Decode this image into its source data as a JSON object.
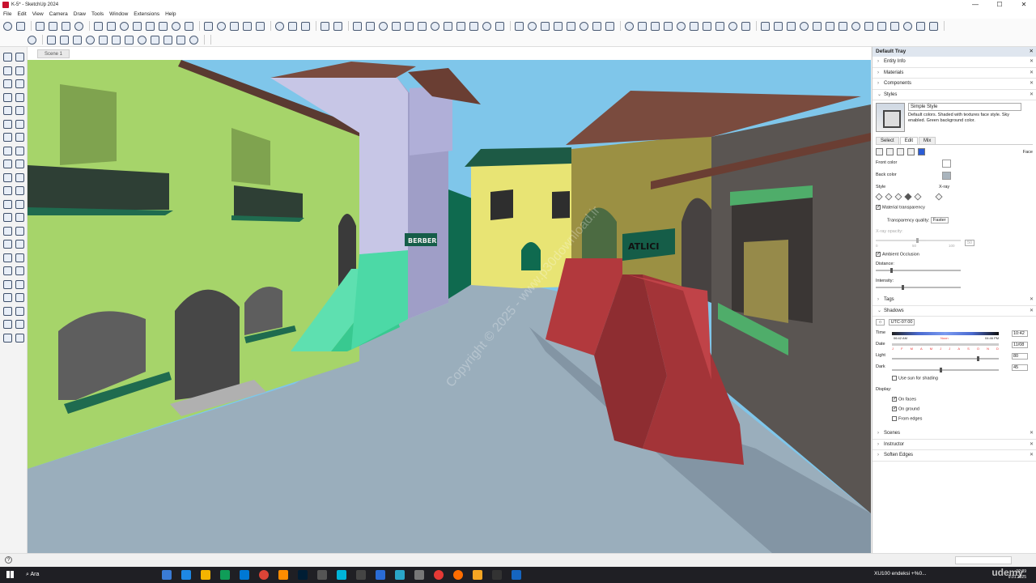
{
  "window": {
    "title": "K-5* - SketchUp 2024",
    "minimize": "—",
    "maximize": "☐",
    "close": "✕"
  },
  "menu": [
    "File",
    "Edit",
    "View",
    "Camera",
    "Draw",
    "Tools",
    "Window",
    "Extensions",
    "Help"
  ],
  "viewport": {
    "scene_tab": "Scene 1",
    "watermark": "Copyright © 2025 - www.p30download.ir",
    "signs": [
      "BERBER",
      "ATLICI"
    ]
  },
  "tray": {
    "title": "Default Tray",
    "close": "✕",
    "sections_top": [
      "Entity Info",
      "Materials",
      "Components"
    ],
    "styles": {
      "header": "Styles",
      "style_name": "Simple Style",
      "description": "Default colors. Shaded with textures face style. Sky enabled. Green background color.",
      "tabs": [
        "Select",
        "Edit",
        "Mix"
      ],
      "face_label": "Face",
      "front_color": "Front color",
      "back_color": "Back color",
      "style_label": "Style",
      "xray_label": "X-ray",
      "material_transparency": "Material transparency",
      "transparency_quality": "Transparency quality:",
      "transparency_value": "Faster",
      "xray_opacity": "X-ray opacity:",
      "xray_ticks": [
        "0",
        "50",
        "100"
      ],
      "xray_value": "50",
      "ambient_occlusion": "Ambient Occlusion",
      "distance": "Distance:",
      "intensity": "Intensity:"
    },
    "tags": "Tags",
    "shadows": {
      "header": "Shadows",
      "timezone": "UTC-07:00",
      "time_label": "Time",
      "time_start": "06:42 AM",
      "time_noon": "Noon",
      "time_end": "04:46 PM",
      "time_value": "10:42",
      "date_label": "Date",
      "months": [
        "J",
        "F",
        "M",
        "A",
        "M",
        "J",
        "J",
        "A",
        "S",
        "O",
        "N",
        "D"
      ],
      "date_value": "11/08",
      "light_label": "Light",
      "light_value": "80",
      "dark_label": "Dark",
      "dark_value": "45",
      "use_sun": "Use sun for shading",
      "display_label": "Display:",
      "on_faces": "On faces",
      "on_ground": "On ground",
      "from_edges": "From edges"
    },
    "sections_bottom": [
      "Scenes",
      "Instructor",
      "Soften Edges"
    ]
  },
  "statusbar": {
    "help": "?"
  },
  "taskbar": {
    "search": "Ara",
    "notification": "XU100 endeksi +%0...",
    "time": "12:39",
    "date": "9.01.2025",
    "udemy": "udemy"
  },
  "colors": {
    "sky": "#7fc6ea",
    "ground": "#9aaebc",
    "wall_green": "#a6d46a",
    "wall_lavender": "#c7c6e6",
    "wall_yellow": "#e8e474",
    "wall_olive": "#9b9043",
    "wall_dark": "#5a5552",
    "stairs_red": "#b2393d",
    "stairs_mint": "#5ee0b0",
    "roof": "#7a4b3e",
    "accent_blue": "#1a73e8"
  }
}
